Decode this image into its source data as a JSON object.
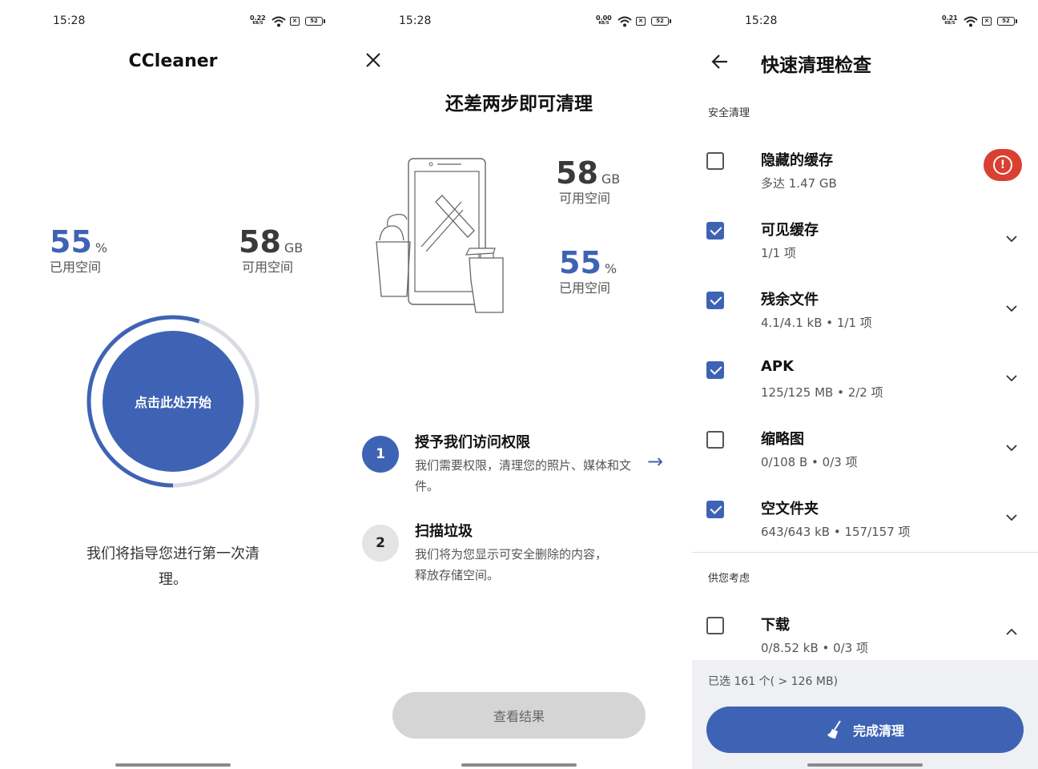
{
  "status_bars": [
    {
      "time": "15:28",
      "speed": "0.22",
      "speed_unit": "KB/S",
      "battery": "52"
    },
    {
      "time": "15:28",
      "speed": "0.00",
      "speed_unit": "KB/S",
      "battery": "52"
    },
    {
      "time": "15:28",
      "speed": "0.21",
      "speed_unit": "KB/S",
      "battery": "52"
    }
  ],
  "colors": {
    "accent": "#3f63b4",
    "warning": "#d94031",
    "disabled_button": "#d5d5d5"
  },
  "screen1": {
    "title": "CCleaner",
    "used": {
      "value": "55",
      "unit": "%",
      "label": "已用空间"
    },
    "free": {
      "value": "58",
      "unit": "GB",
      "label": "可用空间"
    },
    "used_fraction": 0.55,
    "start_button": "点击此处开始",
    "guide_text": "我们将指导您进行第一次清理。"
  },
  "screen2": {
    "close_icon": "close-icon",
    "title": "还差两步即可清理",
    "free": {
      "value": "58",
      "unit": "GB",
      "label": "可用空间"
    },
    "used": {
      "value": "55",
      "unit": "%",
      "label": "已用空间"
    },
    "steps": [
      {
        "number": "1",
        "title": "授予我们访问权限",
        "desc": "我们需要权限，清理您的照片、媒体和文件。"
      },
      {
        "number": "2",
        "title": "扫描垃圾",
        "desc": "我们将为您显示可安全删除的内容，释放存储空间。"
      }
    ],
    "view_results": "查看结果"
  },
  "screen3": {
    "title": "快速清理检查",
    "section_safe": "安全清理",
    "section_consider": "供您考虑",
    "items": [
      {
        "name": "隐藏的缓存",
        "sub": "多达 1.47 GB",
        "checked": false,
        "warning": true
      },
      {
        "name": "可见缓存",
        "sub": "1/1 项",
        "checked": true
      },
      {
        "name": "残余文件",
        "sub": "4.1/4.1 kB • 1/1 项",
        "checked": true
      },
      {
        "name": "APK",
        "sub": "125/125 MB • 2/2 项",
        "checked": true
      },
      {
        "name": "缩略图",
        "sub": "0/108 B • 0/3 项",
        "checked": false
      },
      {
        "name": "空文件夹",
        "sub": "643/643 kB • 157/157 项",
        "checked": true
      }
    ],
    "consider_items": [
      {
        "name": "下载",
        "sub": "0/8.52 kB • 0/3 项",
        "checked": false
      }
    ],
    "selected_info": "已选 161 个( > 126 MB)",
    "finish_button": "完成清理"
  }
}
